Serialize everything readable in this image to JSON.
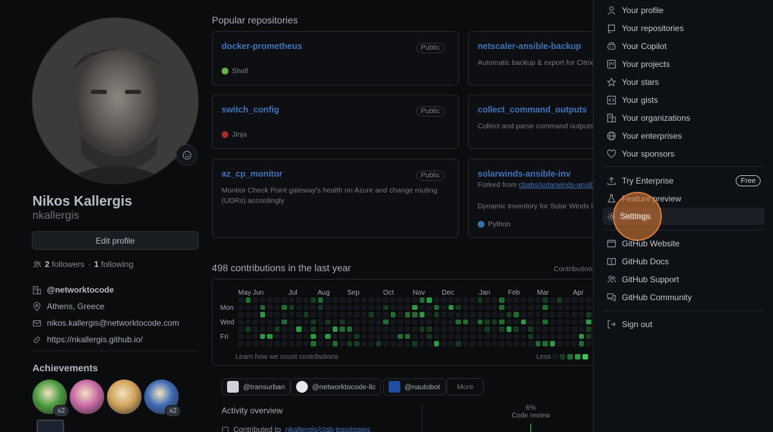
{
  "profile": {
    "fullname": "Nikos Kallergis",
    "username": "nkallergis",
    "edit_label": "Edit profile",
    "followers_count": "2",
    "followers_label": "followers",
    "following_count": "1",
    "following_label": "following",
    "org": "@networktocode",
    "location": "Athens, Greece",
    "email": "nikos.kallergis@networktocode.com",
    "website": "https://nkallergis.github.io/"
  },
  "achievements": {
    "title": "Achievements",
    "badges": [
      {
        "name": "pair-extraordinaire",
        "count": "x2",
        "color": "#4a9b3f"
      },
      {
        "name": "yolo",
        "count": "",
        "color": "#c86aa5"
      },
      {
        "name": "quickdraw",
        "count": "",
        "color": "#d2a35a"
      },
      {
        "name": "pull-shark",
        "count": "x2",
        "color": "#3c6ab5"
      }
    ]
  },
  "popular": {
    "title": "Popular repositories",
    "repos": [
      {
        "name": "docker-prometheus",
        "visibility": "Public",
        "description": "",
        "language": "Shell",
        "lang_color": "#6ab04c"
      },
      {
        "name": "netscaler-ansible-backup",
        "visibility": "Public",
        "description": "Automatic backup & export for Citrix",
        "language": "",
        "lang_color": ""
      },
      {
        "name": "switch_config",
        "visibility": "Public",
        "description": "",
        "language": "Jinja",
        "lang_color": "#a52a2a"
      },
      {
        "name": "collect_command_outputs",
        "visibility": "Public",
        "description": "Collect and parse command outputs",
        "language": "",
        "lang_color": ""
      },
      {
        "name": "az_cp_monitor",
        "visibility": "Public",
        "description": "Monitor Check Point gateway's health on Azure and change routing (UDRs) accordingly",
        "language": "",
        "lang_color": ""
      },
      {
        "name": "solarwinds-ansible-inv",
        "visibility": "Public",
        "forked_prefix": "Forked from ",
        "forked_from": "cbabs/solarwinds-ansib",
        "description": "Dynamic Inventory for Solar Winds h",
        "language": "Python",
        "lang_color": "#3572A5"
      }
    ]
  },
  "contributions": {
    "title": "498 contributions in the last year",
    "settings_label": "Contribution",
    "months": [
      "May",
      "Jun",
      "Jul",
      "Aug",
      "Sep",
      "Oct",
      "Nov",
      "Dec",
      "Jan",
      "Feb",
      "Mar",
      "Apr"
    ],
    "days": [
      "Mon",
      "Wed",
      "Fri"
    ],
    "learn": "Learn how we count contributions",
    "less": "Less",
    "colors": [
      "#161b22",
      "#0e4429",
      "#006d32",
      "#26a641",
      "#39d353"
    ]
  },
  "orgs": [
    {
      "name": "@transurban",
      "logo_color": "#cfd3d8"
    },
    {
      "name": "@networktocode-llc",
      "logo_color": "#e6e8ea"
    },
    {
      "name": "@nautobot",
      "logo_color": "#1d4fa0"
    }
  ],
  "more_label": "More",
  "activity": {
    "title": "Activity overview",
    "contributed_prefix": "Contributed to",
    "contributed_repo": "nkallergis/clab-topologies",
    "code_review_pct": "6%",
    "code_review_label": "Code review"
  },
  "menu": {
    "groups": [
      [
        {
          "label": "Your profile",
          "icon": "person-icon"
        },
        {
          "label": "Your repositories",
          "icon": "repo-icon"
        },
        {
          "label": "Your Copilot",
          "icon": "copilot-icon"
        },
        {
          "label": "Your projects",
          "icon": "project-icon"
        },
        {
          "label": "Your stars",
          "icon": "star-icon"
        },
        {
          "label": "Your gists",
          "icon": "code-square-icon"
        },
        {
          "label": "Your organizations",
          "icon": "organization-icon"
        },
        {
          "label": "Your enterprises",
          "icon": "globe-icon"
        },
        {
          "label": "Your sponsors",
          "icon": "heart-icon"
        }
      ],
      [
        {
          "label": "Try Enterprise",
          "icon": "upload-icon",
          "badge": "Free"
        },
        {
          "label": "Feature preview",
          "icon": "beaker-icon"
        },
        {
          "label": "Settings",
          "icon": "gear-icon",
          "active": true
        }
      ],
      [
        {
          "label": "GitHub Website",
          "icon": "browser-icon"
        },
        {
          "label": "GitHub Docs",
          "icon": "book-icon"
        },
        {
          "label": "GitHub Support",
          "icon": "people-icon"
        },
        {
          "label": "GitHub Community",
          "icon": "comment-discussion-icon"
        }
      ],
      [
        {
          "label": "Sign out",
          "icon": "sign-out-icon"
        }
      ]
    ]
  }
}
